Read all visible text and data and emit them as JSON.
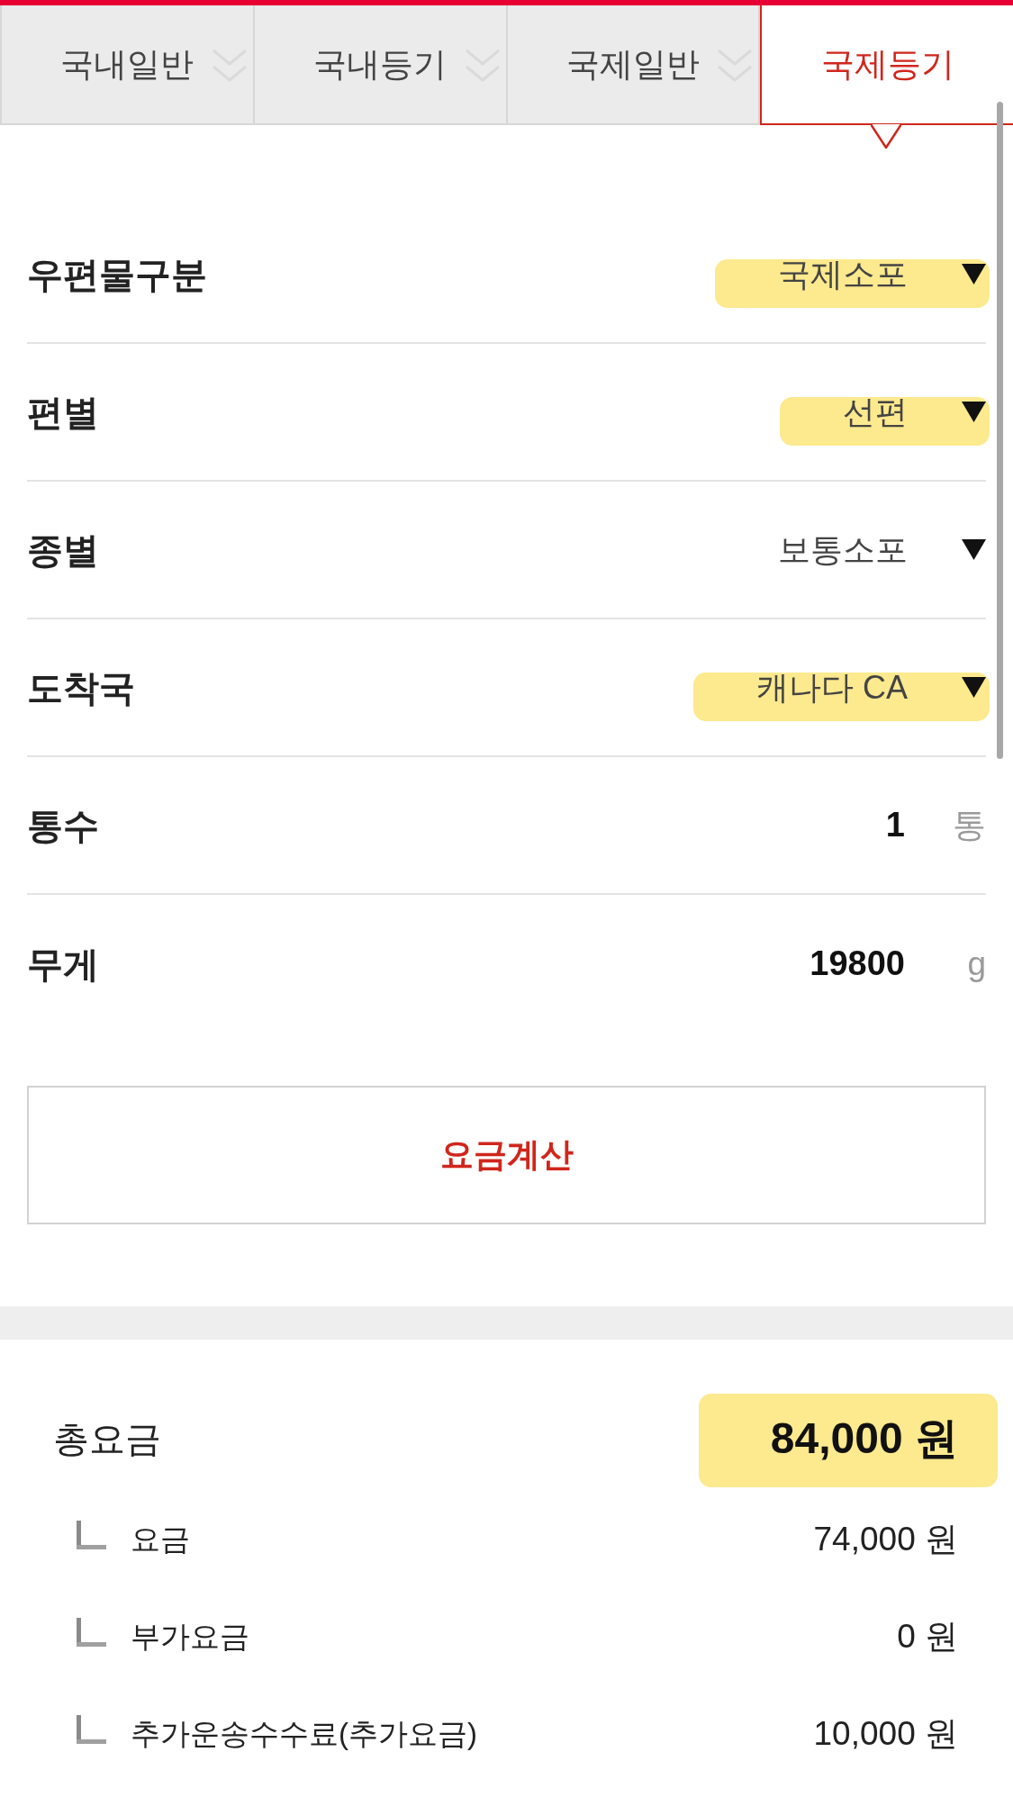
{
  "tabs": [
    {
      "label": "국내일반",
      "selected": false
    },
    {
      "label": "국내등기",
      "selected": false
    },
    {
      "label": "국제일반",
      "selected": false
    },
    {
      "label": "국제등기",
      "selected": true
    }
  ],
  "form": {
    "rows": [
      {
        "kind": "select",
        "label": "우편물구분",
        "value": "국제소포",
        "highlighted": true
      },
      {
        "kind": "select",
        "label": "편별",
        "value": "선편",
        "highlighted": true
      },
      {
        "kind": "select",
        "label": "종별",
        "value": "보통소포",
        "highlighted": false
      },
      {
        "kind": "select",
        "label": "도착국",
        "value": "캐나다 CA",
        "highlighted": true
      },
      {
        "kind": "number",
        "label": "통수",
        "value": "1",
        "unit": "통"
      },
      {
        "kind": "number",
        "label": "무게",
        "value": "19800",
        "unit": "g"
      }
    ]
  },
  "calculate_button": {
    "label": "요금계산"
  },
  "result": {
    "total": {
      "label": "총요금",
      "value": "84,000 원",
      "highlighted": true
    },
    "items": [
      {
        "label": "요금",
        "value": "74,000 원"
      },
      {
        "label": "부가요금",
        "value": "0 원"
      },
      {
        "label": "추가운송수수료(추가요금)",
        "value": "10,000 원"
      }
    ]
  }
}
